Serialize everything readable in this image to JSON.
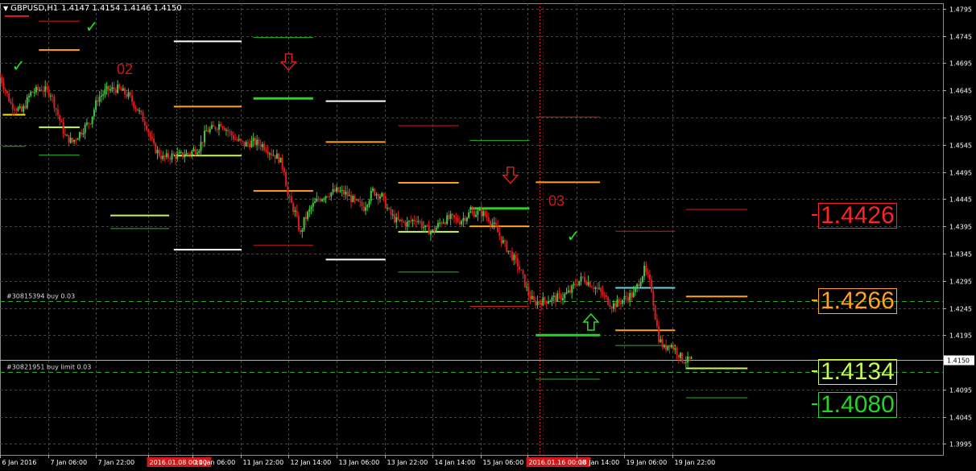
{
  "header": {
    "symbol_label": "GBPUSD,H1",
    "ohlc": "1.4147 1.4154 1.4146 1.4150"
  },
  "colors": {
    "background": "#000000",
    "grid": "#3e4a3e",
    "bull_candle": "#45c645",
    "bear_candle": "#dc1e1e",
    "axis_text": "#ffffff",
    "current_price_bg": "#ffffff",
    "order_line": "#2fa52f",
    "session_separator": "#c81e1e"
  },
  "orders": [
    {
      "label": "#30815394 buy 0.03",
      "price": 1.4257
    },
    {
      "label": "#30821951 buy limit 0.03",
      "price": 1.4128
    }
  ],
  "price_labels": [
    {
      "text": "1.4426",
      "value": 1.4426,
      "color": "#ff2424"
    },
    {
      "text": "1.4266",
      "value": 1.4266,
      "color": "#ffa21c"
    },
    {
      "text": "1.4134",
      "value": 1.4134,
      "color": "#c9f94a"
    },
    {
      "text": "1.4080",
      "value": 1.408,
      "color": "#25d525"
    }
  ],
  "annotations": [
    {
      "type": "text",
      "text": "02",
      "x": 12.9,
      "y": 1.4675,
      "color": "#d01818"
    },
    {
      "type": "text",
      "text": "03",
      "x": 60.6,
      "y": 1.4433,
      "color": "#d01818"
    },
    {
      "type": "down-arrow-icon",
      "x": 31.9,
      "y": 1.4694
    },
    {
      "type": "down-arrow-icon",
      "x": 56.4,
      "y": 1.4486
    },
    {
      "type": "up-arrow-icon",
      "x": 65.3,
      "y": 1.4222
    },
    {
      "type": "check-icon",
      "x": 1.3,
      "y": 1.468
    },
    {
      "type": "check-icon",
      "x": 9.4,
      "y": 1.4752
    },
    {
      "type": "check-icon",
      "x": 62.6,
      "y": 1.4367
    }
  ],
  "chart_data": {
    "type": "candlestick",
    "title": "GBPUSD,H1",
    "ylim": [
      1.3975,
      1.4805
    ],
    "xlim": [
      0,
      104.2
    ],
    "y_ticks": [
      1.4795,
      1.4745,
      1.4695,
      1.4645,
      1.4595,
      1.4545,
      1.4495,
      1.4445,
      1.4395,
      1.4345,
      1.4295,
      1.4245,
      1.4195,
      1.415,
      1.4095,
      1.4045,
      1.3995
    ],
    "current_price": "1.4150",
    "x_ticks": [
      {
        "label": "6 Jan 2016",
        "x": 0
      },
      {
        "label": "7 Jan 06:00",
        "x": 5.3
      },
      {
        "label": "7 Jan 22:00",
        "x": 10.6
      },
      {
        "label": "2016.01.08 00:00",
        "x": 16.4,
        "highlight": true
      },
      {
        "label": "11 Jan 06:00",
        "x": 21.3
      },
      {
        "label": "11 Jan 22:00",
        "x": 26.6
      },
      {
        "label": "12 Jan 14:00",
        "x": 31.9
      },
      {
        "label": "13 Jan 06:00",
        "x": 37.2
      },
      {
        "label": "13 Jan 22:00",
        "x": 42.5
      },
      {
        "label": "14 Jan 14:00",
        "x": 47.8
      },
      {
        "label": "15 Jan 06:00",
        "x": 53.1
      },
      {
        "label": "2016.01.16 00:00",
        "x": 58.3,
        "highlight": true
      },
      {
        "label": "18 Jan 14:00",
        "x": 63.7
      },
      {
        "label": "19 Jan 06:00",
        "x": 69.0
      },
      {
        "label": "19 Jan 22:00",
        "x": 74.3
      }
    ],
    "vertical_markers": [
      19.5,
      59.6
    ],
    "level_segments": [
      {
        "x0": 4.3,
        "x1": 8.8,
        "y": 1.4772,
        "color": "#c81e1e",
        "w": 1
      },
      {
        "x0": 4.3,
        "x1": 8.8,
        "y": 1.4719,
        "color": "#ffa21c",
        "w": 2
      },
      {
        "x0": 4.3,
        "x1": 8.8,
        "y": 1.4577,
        "color": "#c9f94a",
        "w": 2
      },
      {
        "x0": 4.3,
        "x1": 8.8,
        "y": 1.4526,
        "color": "#25b525",
        "w": 1
      },
      {
        "x0": 0.3,
        "x1": 2.8,
        "y": 1.46,
        "color": "#ffe000",
        "w": 2
      },
      {
        "x0": 0.3,
        "x1": 2.8,
        "y": 1.4542,
        "color": "#25b525",
        "w": 1
      },
      {
        "x0": 12.2,
        "x1": 18.7,
        "y": 1.4415,
        "color": "#c9f94a",
        "w": 2
      },
      {
        "x0": 12.2,
        "x1": 18.7,
        "y": 1.4391,
        "color": "#25b525",
        "w": 1
      },
      {
        "x0": 19.2,
        "x1": 26.7,
        "y": 1.4735,
        "color": "#ffffff",
        "w": 2
      },
      {
        "x0": 19.2,
        "x1": 26.7,
        "y": 1.4615,
        "color": "#ffa21c",
        "w": 2
      },
      {
        "x0": 19.2,
        "x1": 26.7,
        "y": 1.4525,
        "color": "#c9f94a",
        "w": 2
      },
      {
        "x0": 19.2,
        "x1": 26.7,
        "y": 1.4352,
        "color": "#ffffff",
        "w": 2
      },
      {
        "x0": 28.0,
        "x1": 34.6,
        "y": 1.4742,
        "color": "#25b525",
        "w": 1
      },
      {
        "x0": 28.0,
        "x1": 34.6,
        "y": 1.463,
        "color": "#25d525",
        "w": 3
      },
      {
        "x0": 28.0,
        "x1": 34.6,
        "y": 1.446,
        "color": "#ffa21c",
        "w": 2
      },
      {
        "x0": 28.0,
        "x1": 34.6,
        "y": 1.436,
        "color": "#c81e1e",
        "w": 1
      },
      {
        "x0": 36.0,
        "x1": 42.6,
        "y": 1.4625,
        "color": "#ffffff",
        "w": 2
      },
      {
        "x0": 36.0,
        "x1": 42.6,
        "y": 1.455,
        "color": "#ffa21c",
        "w": 2
      },
      {
        "x0": 36.0,
        "x1": 42.6,
        "y": 1.4334,
        "color": "#ffffff",
        "w": 2
      },
      {
        "x0": 44.0,
        "x1": 50.7,
        "y": 1.458,
        "color": "#c81e1e",
        "w": 1
      },
      {
        "x0": 44.0,
        "x1": 50.7,
        "y": 1.4475,
        "color": "#ffa21c",
        "w": 2
      },
      {
        "x0": 44.0,
        "x1": 50.7,
        "y": 1.4385,
        "color": "#c9f94a",
        "w": 2
      },
      {
        "x0": 44.0,
        "x1": 50.7,
        "y": 1.4311,
        "color": "#25b525",
        "w": 1
      },
      {
        "x0": 51.9,
        "x1": 58.5,
        "y": 1.4553,
        "color": "#25b525",
        "w": 1
      },
      {
        "x0": 51.9,
        "x1": 58.5,
        "y": 1.4428,
        "color": "#25d525",
        "w": 3
      },
      {
        "x0": 51.9,
        "x1": 58.5,
        "y": 1.4395,
        "color": "#ffa21c",
        "w": 2
      },
      {
        "x0": 51.9,
        "x1": 58.5,
        "y": 1.4248,
        "color": "#c81e1e",
        "w": 1
      },
      {
        "x0": 59.2,
        "x1": 66.3,
        "y": 1.4596,
        "color": "#c81e1e",
        "w": 1
      },
      {
        "x0": 59.2,
        "x1": 66.3,
        "y": 1.4476,
        "color": "#ffa21c",
        "w": 2
      },
      {
        "x0": 59.2,
        "x1": 66.3,
        "y": 1.4195,
        "color": "#25d525",
        "w": 3
      },
      {
        "x0": 59.2,
        "x1": 66.3,
        "y": 1.4114,
        "color": "#25b525",
        "w": 1
      },
      {
        "x0": 68.0,
        "x1": 74.6,
        "y": 1.4386,
        "color": "#c81e1e",
        "w": 1
      },
      {
        "x0": 68.0,
        "x1": 74.6,
        "y": 1.4282,
        "color": "#5fd8e0",
        "w": 2
      },
      {
        "x0": 68.0,
        "x1": 74.6,
        "y": 1.4204,
        "color": "#ffa21c",
        "w": 2
      },
      {
        "x0": 68.0,
        "x1": 74.6,
        "y": 1.4176,
        "color": "#25b525",
        "w": 1
      },
      {
        "x0": 75.8,
        "x1": 82.6,
        "y": 1.4426,
        "color": "#c81e1e",
        "w": 1
      },
      {
        "x0": 75.8,
        "x1": 82.6,
        "y": 1.4266,
        "color": "#ffa21c",
        "w": 2
      },
      {
        "x0": 75.8,
        "x1": 82.6,
        "y": 1.4134,
        "color": "#c9f94a",
        "w": 2
      },
      {
        "x0": 75.8,
        "x1": 82.6,
        "y": 1.408,
        "color": "#25b525",
        "w": 1
      }
    ],
    "price_path": [
      [
        0,
        1.467
      ],
      [
        1.2,
        1.462
      ],
      [
        2.4,
        1.4605
      ],
      [
        3.4,
        1.464
      ],
      [
        4.6,
        1.4648
      ],
      [
        5.6,
        1.464
      ],
      [
        6.4,
        1.46
      ],
      [
        7.2,
        1.456
      ],
      [
        8.0,
        1.455
      ],
      [
        9.0,
        1.457
      ],
      [
        10.0,
        1.459
      ],
      [
        10.8,
        1.463
      ],
      [
        11.8,
        1.4645
      ],
      [
        13.0,
        1.4648
      ],
      [
        14.2,
        1.4635
      ],
      [
        15.2,
        1.461
      ],
      [
        16.2,
        1.458
      ],
      [
        17.0,
        1.454
      ],
      [
        18.0,
        1.452
      ],
      [
        19.0,
        1.4525
      ],
      [
        20.0,
        1.4525
      ],
      [
        21.0,
        1.453
      ],
      [
        22.0,
        1.454
      ],
      [
        22.8,
        1.457
      ],
      [
        23.6,
        1.4575
      ],
      [
        24.4,
        1.4585
      ],
      [
        25.2,
        1.457
      ],
      [
        26.0,
        1.4555
      ],
      [
        27.0,
        1.4545
      ],
      [
        28.0,
        1.455
      ],
      [
        29.0,
        1.4545
      ],
      [
        30.0,
        1.453
      ],
      [
        30.8,
        1.452
      ],
      [
        31.4,
        1.45
      ],
      [
        31.8,
        1.445
      ],
      [
        32.6,
        1.442
      ],
      [
        33.2,
        1.438
      ],
      [
        33.6,
        1.4405
      ],
      [
        34.4,
        1.443
      ],
      [
        35.2,
        1.4445
      ],
      [
        36.2,
        1.4455
      ],
      [
        37.2,
        1.446
      ],
      [
        38.2,
        1.4455
      ],
      [
        39.2,
        1.444
      ],
      [
        40.2,
        1.443
      ],
      [
        41.2,
        1.446
      ],
      [
        42.2,
        1.445
      ],
      [
        43.0,
        1.442
      ],
      [
        43.8,
        1.4405
      ],
      [
        45.0,
        1.44
      ],
      [
        46.0,
        1.441
      ],
      [
        47.0,
        1.439
      ],
      [
        47.8,
        1.4385
      ],
      [
        48.8,
        1.4405
      ],
      [
        49.8,
        1.441
      ],
      [
        50.8,
        1.4405
      ],
      [
        52.0,
        1.442
      ],
      [
        53.2,
        1.442
      ],
      [
        54.0,
        1.441
      ],
      [
        54.8,
        1.439
      ],
      [
        55.6,
        1.4365
      ],
      [
        56.4,
        1.4345
      ],
      [
        57.2,
        1.4325
      ],
      [
        57.8,
        1.43
      ],
      [
        58.4,
        1.427
      ],
      [
        59.0,
        1.4255
      ],
      [
        60.0,
        1.4258
      ],
      [
        61.0,
        1.4262
      ],
      [
        62.0,
        1.4265
      ],
      [
        63.0,
        1.4275
      ],
      [
        63.6,
        1.429
      ],
      [
        64.4,
        1.43
      ],
      [
        65.2,
        1.429
      ],
      [
        66.0,
        1.428
      ],
      [
        66.8,
        1.4265
      ],
      [
        67.6,
        1.425
      ],
      [
        68.4,
        1.4255
      ],
      [
        69.2,
        1.4265
      ],
      [
        70.0,
        1.427
      ],
      [
        70.8,
        1.43
      ],
      [
        71.2,
        1.4315
      ],
      [
        71.6,
        1.43
      ],
      [
        72.0,
        1.428
      ],
      [
        72.4,
        1.423
      ],
      [
        72.8,
        1.419
      ],
      [
        73.4,
        1.417
      ],
      [
        74.0,
        1.418
      ],
      [
        74.8,
        1.4165
      ],
      [
        75.4,
        1.415
      ],
      [
        76.0,
        1.4148
      ],
      [
        76.6,
        1.415
      ]
    ]
  }
}
